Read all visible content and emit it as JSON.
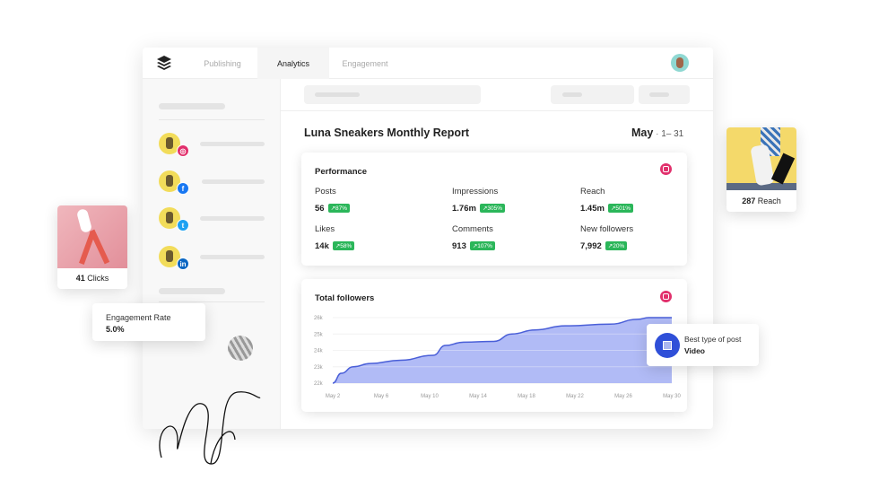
{
  "nav": {
    "tabs": [
      {
        "label": "Publishing"
      },
      {
        "label": "Analytics",
        "active": true
      },
      {
        "label": "Engagement"
      }
    ]
  },
  "sidebar": {
    "accounts": [
      {
        "network": "instagram",
        "color": "#e1306c"
      },
      {
        "network": "facebook",
        "color": "#1877f2"
      },
      {
        "network": "twitter",
        "color": "#1da1f2"
      },
      {
        "network": "linkedin",
        "color": "#0a66c2"
      }
    ]
  },
  "report": {
    "title": "Luna Sneakers Monthly Report",
    "month": "May",
    "range": "1– 31"
  },
  "performance": {
    "title": "Performance",
    "metrics": [
      {
        "label": "Posts",
        "value": "56",
        "change": "↗87%"
      },
      {
        "label": "Impressions",
        "value": "1.76m",
        "change": "↗305%"
      },
      {
        "label": "Reach",
        "value": "1.45m",
        "change": "↗501%"
      },
      {
        "label": "Likes",
        "value": "14k",
        "change": "↗58%"
      },
      {
        "label": "Comments",
        "value": "913",
        "change": "↗107%"
      },
      {
        "label": "New followers",
        "value": "7,992",
        "change": "↗20%"
      }
    ]
  },
  "chart_data": {
    "type": "area",
    "title": "Total followers",
    "xlabel": "",
    "ylabel": "",
    "x_ticks": [
      "May 2",
      "May 6",
      "May 10",
      "May 14",
      "May 18",
      "May 22",
      "May 26",
      "May 30"
    ],
    "y_ticks": [
      "22k",
      "23k",
      "24k",
      "25k",
      "26k"
    ],
    "ylim": [
      22000,
      26000
    ],
    "xlim": [
      2,
      30
    ],
    "grid": true,
    "color": "#4a5fd8",
    "fill": "#a9b4f5",
    "x": [
      2,
      2.7,
      3.7,
      5.1,
      7.6,
      10.3,
      11.3,
      12.8,
      15.3,
      16.8,
      18.7,
      21.2,
      24.9,
      27.2,
      28.1,
      30
    ],
    "y": [
      22000,
      22600,
      23000,
      23200,
      23400,
      23700,
      24300,
      24500,
      24550,
      25000,
      25250,
      25500,
      25600,
      25900,
      26000,
      26000
    ]
  },
  "floats": {
    "clicks": {
      "value": "41",
      "label": "Clicks"
    },
    "engagement": {
      "label": "Engagement Rate",
      "value": "5.0%"
    },
    "reach": {
      "value": "287",
      "label": "Reach"
    },
    "best_post": {
      "label": "Best type of post",
      "value": "Video"
    }
  }
}
